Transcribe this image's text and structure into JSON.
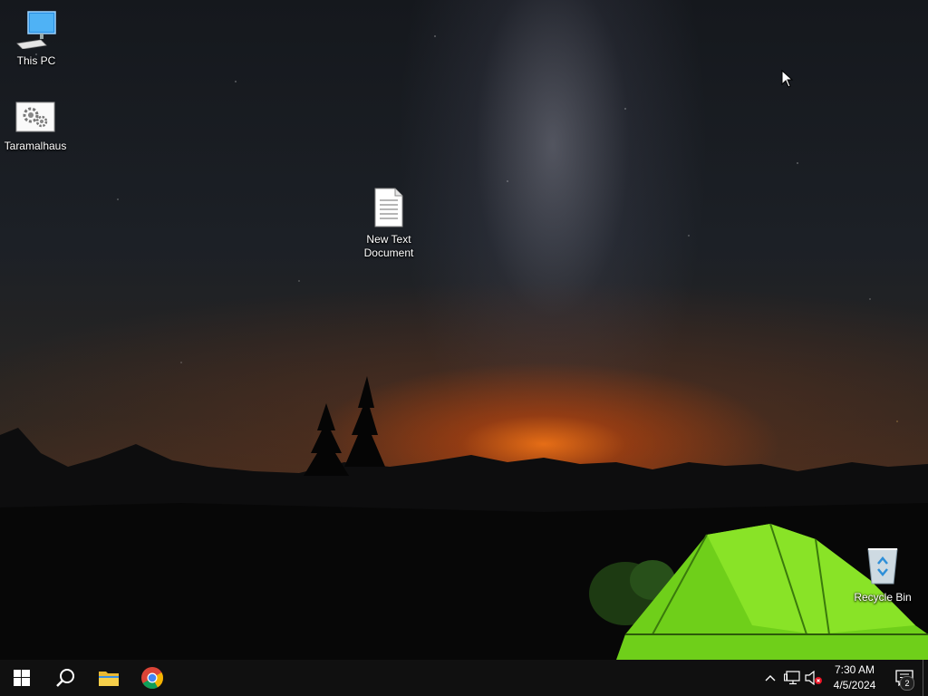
{
  "desktop": {
    "icons": [
      {
        "label": "This PC",
        "icon": "computer-icon"
      },
      {
        "label": "Taramalhaus",
        "icon": "settings-window-icon"
      },
      {
        "label": "New Text Document",
        "icon": "text-document-icon"
      },
      {
        "label": "Recycle Bin",
        "icon": "recycle-bin-icon"
      }
    ]
  },
  "taskbar": {
    "start": {
      "icon": "windows-start-icon"
    },
    "search": {
      "icon": "search-icon"
    },
    "pinned": [
      {
        "icon": "file-explorer-icon"
      },
      {
        "icon": "chrome-icon"
      }
    ],
    "tray": {
      "chevron_icon": "chevron-up-icon",
      "network_icon": "network-icon",
      "volume_icon": "volume-muted-icon",
      "time": "7:30 AM",
      "date": "4/5/2024",
      "notification_count": "2"
    }
  },
  "colors": {
    "taskbar_bg": "#101010",
    "tent_green": "#7ddc1f",
    "horizon_glow": "#ff7a14"
  }
}
